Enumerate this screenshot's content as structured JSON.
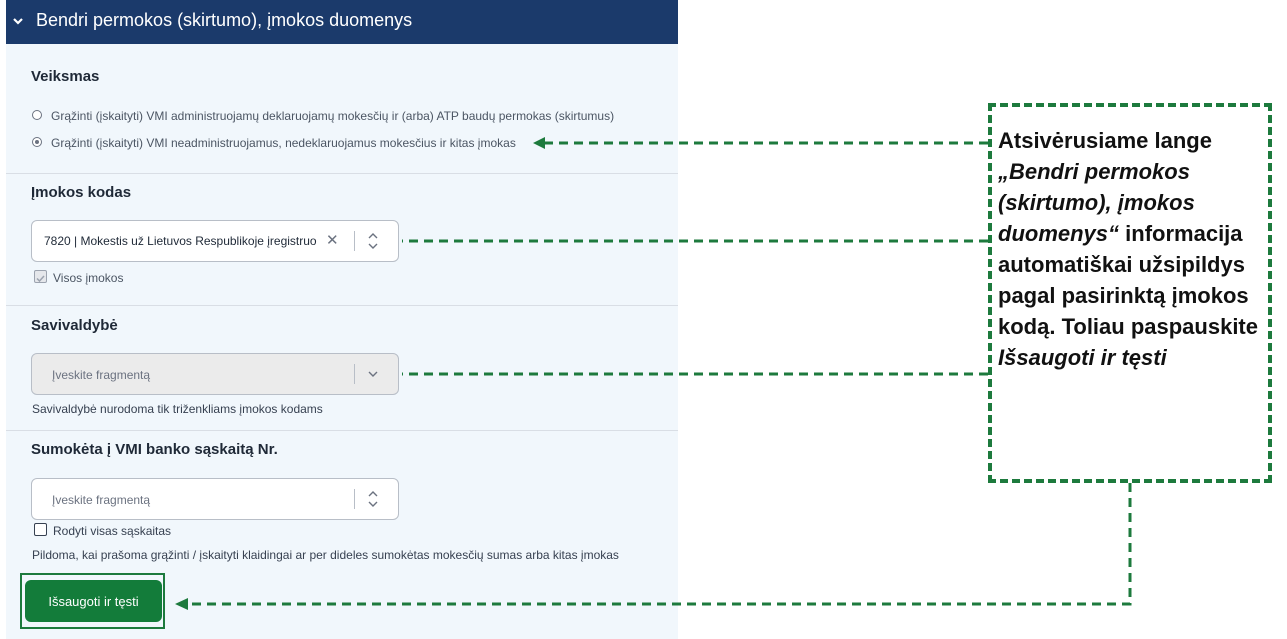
{
  "header": {
    "title": "Bendri permokos (skirtumo), įmokos duomenys",
    "icon": "chevron-down-icon"
  },
  "veiksmas": {
    "title": "Veiksmas",
    "options": [
      {
        "label": "Grąžinti (įskaityti) VMI administruojamų deklaruojamų mokesčių ir (arba) ATP baudų permokas (skirtumus)",
        "selected": false
      },
      {
        "label": "Grąžinti (įskaityti) VMI neadministruojamus, nedeklaruojamus mokesčius ir kitas įmokas",
        "selected": true
      }
    ]
  },
  "imokos_kodas": {
    "title": "Įmokos kodas",
    "value": "7820 |  Mokestis už Lietuvos Respublikoje įregistruo",
    "checkbox_label": "Visos įmokos",
    "checkbox_checked": true
  },
  "savivaldybe": {
    "title": "Savivaldybė",
    "placeholder": "Įveskite fragmentą",
    "hint": "Savivaldybė nurodoma tik triženkliams įmokos kodams"
  },
  "saskaita": {
    "title": "Sumokėta į VMI banko sąskaitą Nr.",
    "placeholder": "Įveskite fragmentą",
    "checkbox_label": "Rodyti visas sąskaitas",
    "checkbox_checked": false,
    "hint": "Pildoma, kai prašoma grąžinti / įskaityti klaidingai ar per dideles sumokėtas mokesčių sumas arba kitas įmokas"
  },
  "save_button": "Išsaugoti ir tęsti",
  "callout": {
    "line1": "Atsivėrusiame lange",
    "italic1": "„Bendri permokos (skirtumo), įmokos duomenys“",
    "line2": "informacija automatiškai užsipildys pagal pasirinktą įmokos kodą. Toliau paspauskite",
    "italic2": "Išsaugoti ir tęsti"
  },
  "colors": {
    "header": "#1b3a6b",
    "panel": "#f1f7fc",
    "accent": "#137c3a",
    "callout_border": "#1d7a3d"
  }
}
